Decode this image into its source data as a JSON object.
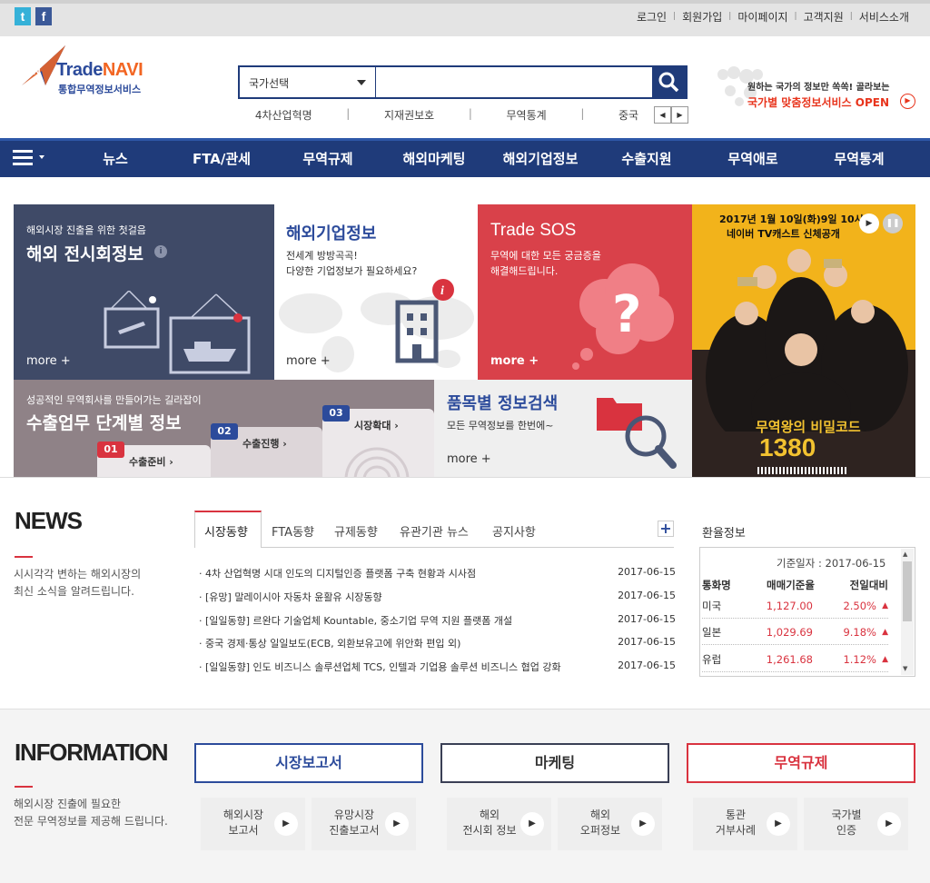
{
  "top": {
    "sns": [
      "t",
      "f"
    ],
    "links": [
      "로그인",
      "회원가입",
      "마이페이지",
      "고객지원",
      "서비스소개"
    ]
  },
  "logo": {
    "name": "TradeNAVI",
    "name_a": "Trade",
    "name_b": "NAVI",
    "sub": "통합무역정보서비스"
  },
  "search": {
    "select": "국가선택",
    "placeholder": ""
  },
  "keywords": [
    "4차산업혁명",
    "지재권보호",
    "무역통계",
    "중국"
  ],
  "promo": {
    "line1": "원하는 국가의 정보만 쏙쏙! 골라보는",
    "line2": "국가별 맞춤정보서비스 OPEN"
  },
  "nav": [
    "뉴스",
    "FTA/관세",
    "무역규제",
    "해외마케팅",
    "해외기업정보",
    "수출지원",
    "무역애로",
    "무역통계"
  ],
  "tiles": {
    "exhibit": {
      "small": "해외시장 진출을 위한 첫걸음",
      "title": "해외 전시회정보",
      "more": "more  +"
    },
    "company": {
      "title": "해외기업정보",
      "desc1": "전세계 방방곡곡!",
      "desc2": "다양한 기업정보가 필요하세요?",
      "more": "more  +"
    },
    "sos": {
      "title": "Trade SOS",
      "desc1": "무역에 대한 모든 궁금증을",
      "desc2": "해결해드립니다.",
      "more": "more  +"
    },
    "steps": {
      "small": "성공적인 무역회사를 만들어가는 길라잡이",
      "title": "수출업무 단계별 정보",
      "s1n": "01",
      "s1": "수출준비 ›",
      "s2n": "02",
      "s2": "수출진행 ›",
      "s3n": "03",
      "s3": "시장확대 ›"
    },
    "item": {
      "title": "품목별 정보검색",
      "desc": "모든 무역정보를 한번에~",
      "more": "more  +"
    },
    "ad": {
      "top1": "2017년 1월 10일(화)9일 10시",
      "top2": "네이버 TV캐스트 신체공개",
      "bottom1": "무역왕의 비밀코드",
      "bottom2": "1380"
    }
  },
  "news": {
    "heading": "NEWS",
    "desc1": "시시각각 변하는 해외시장의",
    "desc2": "최신 소식을 알려드립니다.",
    "tabs": [
      "시장동향",
      "FTA동향",
      "규제동향",
      "유관기관 뉴스",
      "공지사항"
    ],
    "plus": "+",
    "items": [
      {
        "title": "· 4차 산업혁명 시대 인도의 디지털인증 플랫폼 구축 현황과 시사점",
        "date": "2017-06-15"
      },
      {
        "title": "· [유망] 말레이시아 자동차 윤활유 시장동향",
        "date": "2017-06-15"
      },
      {
        "title": "· [일일동향] 르완다 기술업체 Kountable, 중소기업 무역 지원 플랫폼 개설",
        "date": "2017-06-15"
      },
      {
        "title": "· 중국 경제·통상 일일보도(ECB, 외환보유고에 위안화 편입 외)",
        "date": "2017-06-15"
      },
      {
        "title": "· [일일동향] 인도 비즈니스 솔루션업체 TCS, 인텔과 기업용 솔루션 비즈니스 협업 강화",
        "date": "2017-06-15"
      }
    ]
  },
  "exchange": {
    "title": "환율정보",
    "date": "기준일자 : 2017-06-15",
    "headers": [
      "통화명",
      "매매기준율",
      "전일대비"
    ],
    "rows": [
      {
        "cur": "미국",
        "rate": "1,127.00",
        "chg": "2.50%"
      },
      {
        "cur": "일본",
        "rate": "1,029.69",
        "chg": "9.18%"
      },
      {
        "cur": "유럽",
        "rate": "1,261.68",
        "chg": "1.12%"
      }
    ]
  },
  "info": {
    "heading": "INFORMATION",
    "desc1": "해외시장 진출에 필요한",
    "desc2": "전문 무역정보를 제공해 드립니다.",
    "buttons": [
      "시장보고서",
      "마케팅",
      "무역규제"
    ],
    "subs": [
      [
        "해외시장",
        "보고서"
      ],
      [
        "유망시장",
        "진출보고서"
      ],
      [
        "해외",
        "전시회 정보"
      ],
      [
        "해외",
        "오퍼정보"
      ],
      [
        "통관",
        "거부사례"
      ],
      [
        "국가별",
        "인증"
      ]
    ]
  }
}
